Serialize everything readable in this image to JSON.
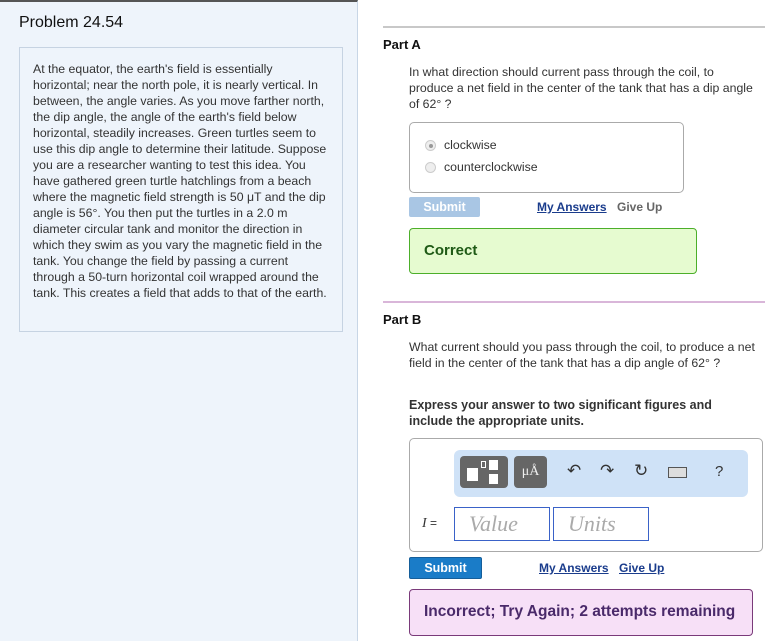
{
  "problem": {
    "title": "Problem 24.54",
    "intro": "At the equator, the earth's field is essentially horizontal; near the north pole, it is nearly vertical. In between, the angle varies. As you move farther north, the dip angle, the angle of the earth's field below horizontal, steadily increases. Green turtles seem to use this dip angle to determine their latitude. Suppose you are a researcher wanting to test this idea. You have gathered green turtle hatchlings from a beach where the magnetic field strength is 50 μT and the dip angle is 56°. You then put the turtles in a 2.0 m diameter circular tank and monitor the direction in which they swim as you vary the magnetic field in the tank. You change the field by passing a current through a 50-turn horizontal coil wrapped around the tank. This creates a field that adds to that of the earth."
  },
  "partA": {
    "heading": "Part A",
    "question": "In what direction should current pass through the coil, to produce a net field in the center of the tank that has a dip angle of 62° ?",
    "options": [
      "clockwise",
      "counterclockwise"
    ],
    "selected": "clockwise",
    "submit": "Submit",
    "my_answers": "My Answers",
    "give_up": "Give Up",
    "feedback": "Correct"
  },
  "partB": {
    "heading": "Part B",
    "question": "What current should you pass through the coil, to produce a net field in the center of the tank that has a dip angle of 62° ?",
    "instruction": "Express your answer to two significant figures and include the appropriate units.",
    "toolbar": {
      "units_btn": "μÅ",
      "help": "?"
    },
    "var_label": "I =",
    "value_placeholder": "Value",
    "units_placeholder": "Units",
    "submit": "Submit",
    "my_answers": "My Answers",
    "give_up": "Give Up",
    "feedback": "Incorrect; Try Again; 2 attempts remaining"
  },
  "colors": {
    "correct_bg": "#e6fbd0",
    "correct_border": "#4caf2a",
    "incorrect_bg": "#f7e0f7",
    "incorrect_border": "#7a3a7a",
    "submit": "#1a7cc8"
  }
}
